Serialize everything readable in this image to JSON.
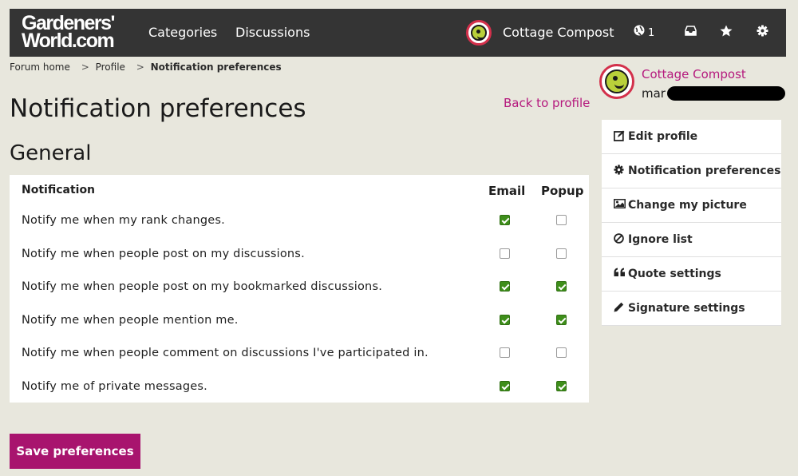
{
  "header": {
    "logo_line1": "Gardeners'",
    "logo_line2": "World.com",
    "nav": [
      "Categories",
      "Discussions"
    ],
    "username": "Cottage Compost",
    "notification_count": "1"
  },
  "breadcrumb": {
    "items": [
      "Forum home",
      "Profile",
      "Notification preferences"
    ],
    "separator": ">"
  },
  "page": {
    "title": "Notification preferences",
    "back_link": "Back to profile",
    "section": "General"
  },
  "table": {
    "headers": {
      "notification": "Notification",
      "email": "Email",
      "popup": "Popup"
    },
    "rows": [
      {
        "label": "Notify me when my rank changes.",
        "email": true,
        "popup": false
      },
      {
        "label": "Notify me when people post on my discussions.",
        "email": false,
        "popup": false
      },
      {
        "label": "Notify me when people post on my bookmarked discussions.",
        "email": true,
        "popup": true
      },
      {
        "label": "Notify me when people mention me.",
        "email": true,
        "popup": true
      },
      {
        "label": "Notify me when people comment on discussions I've participated in.",
        "email": false,
        "popup": false
      },
      {
        "label": "Notify me of private messages.",
        "email": true,
        "popup": true
      }
    ]
  },
  "save_button": "Save preferences",
  "sidebar": {
    "username": "Cottage Compost",
    "subtext": "mar",
    "menu": [
      {
        "label": "Edit profile",
        "icon": "edit-icon"
      },
      {
        "label": "Notification preferences",
        "icon": "gear-icon"
      },
      {
        "label": "Change my picture",
        "icon": "picture-icon"
      },
      {
        "label": "Ignore list",
        "icon": "ban-icon"
      },
      {
        "label": "Quote settings",
        "icon": "quote-icon"
      },
      {
        "label": "Signature settings",
        "icon": "pencil-icon"
      }
    ]
  },
  "colors": {
    "topbar": "#343434",
    "accent": "#b5197d",
    "button": "#a8146e",
    "checked": "#3e8e1a",
    "background": "#e8e7dd"
  }
}
